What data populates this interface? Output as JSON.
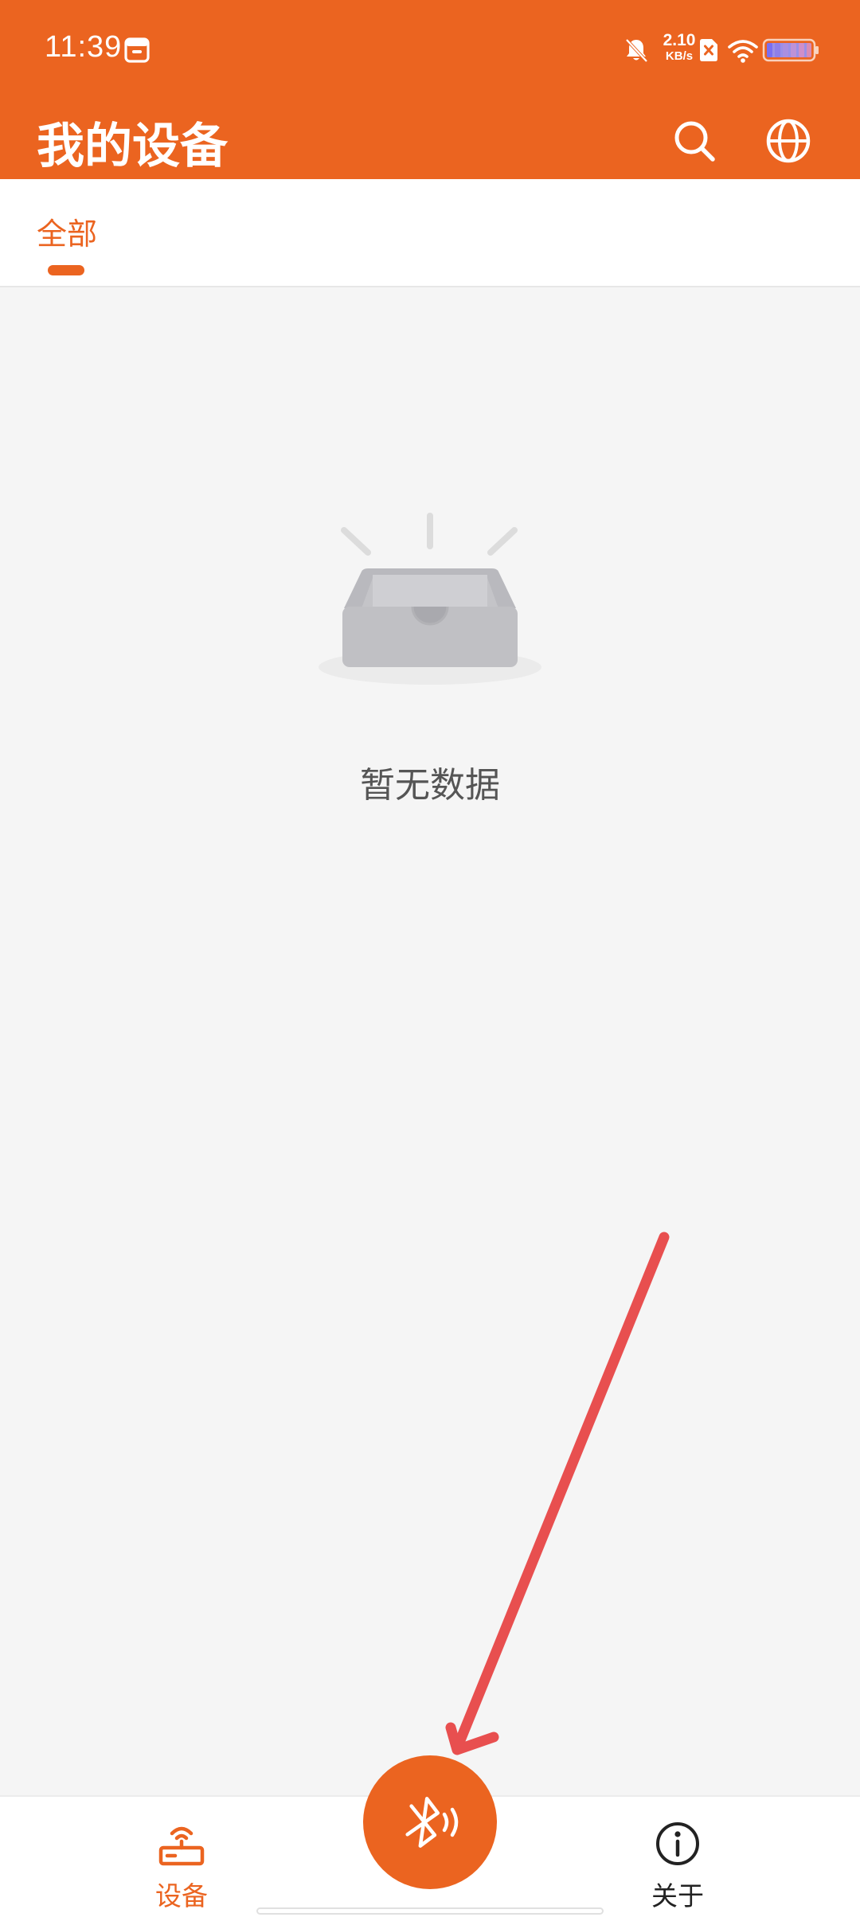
{
  "status_bar": {
    "time": "11:39",
    "network_speed_value": "2.10",
    "network_speed_unit": "KB/s",
    "icons": [
      "app-notification-icon",
      "bell-muted-icon",
      "sim-x-icon",
      "wifi-icon",
      "battery-icon"
    ]
  },
  "app_bar": {
    "title": "我的设备",
    "actions": [
      "search-icon",
      "globe-icon"
    ]
  },
  "tabs": [
    {
      "label": "全部",
      "selected": true
    }
  ],
  "empty_state": {
    "icon": "empty-box-icon",
    "text": "暂无数据"
  },
  "bottom_nav": {
    "items": [
      {
        "label": "设备",
        "icon": "router-icon",
        "active": true
      },
      {
        "label": "关于",
        "icon": "info-icon",
        "active": false
      }
    ],
    "fab_icon": "bluetooth-scan-icon"
  },
  "colors": {
    "brand": "#eb6420",
    "background": "#f5f5f5",
    "surface": "#ffffff",
    "annotation": "#e84f4f"
  }
}
